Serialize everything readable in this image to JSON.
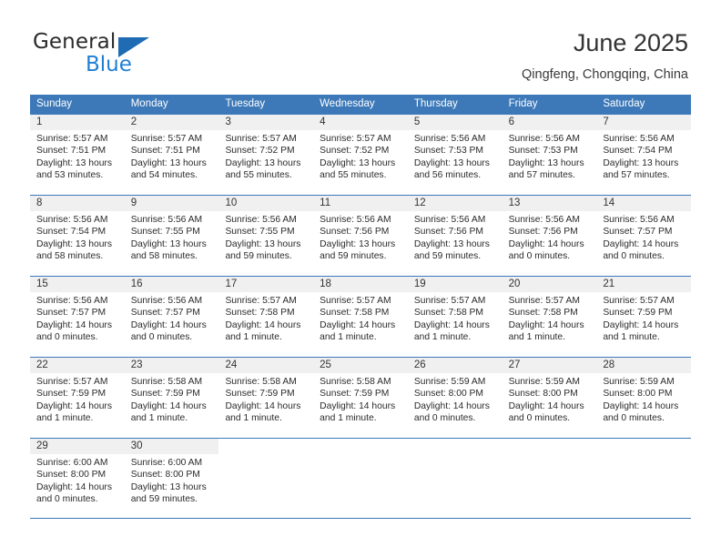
{
  "brand": {
    "name_part1": "General",
    "name_part2": "Blue",
    "triangle_color": "#1f6cb4",
    "blue_color": "#1f7fd4"
  },
  "header": {
    "title": "June 2025",
    "subtitle": "Qingfeng, Chongqing, China"
  },
  "colors": {
    "header_blue": "#3d79b9",
    "daynum_band": "#f0f0f0",
    "text": "#2b2b2b"
  },
  "weekdays": [
    "Sunday",
    "Monday",
    "Tuesday",
    "Wednesday",
    "Thursday",
    "Friday",
    "Saturday"
  ],
  "weeks": [
    [
      {
        "day": "1",
        "sunrise": "Sunrise: 5:57 AM",
        "sunset": "Sunset: 7:51 PM",
        "daylight_line1": "Daylight: 13 hours",
        "daylight_line2": "and 53 minutes."
      },
      {
        "day": "2",
        "sunrise": "Sunrise: 5:57 AM",
        "sunset": "Sunset: 7:51 PM",
        "daylight_line1": "Daylight: 13 hours",
        "daylight_line2": "and 54 minutes."
      },
      {
        "day": "3",
        "sunrise": "Sunrise: 5:57 AM",
        "sunset": "Sunset: 7:52 PM",
        "daylight_line1": "Daylight: 13 hours",
        "daylight_line2": "and 55 minutes."
      },
      {
        "day": "4",
        "sunrise": "Sunrise: 5:57 AM",
        "sunset": "Sunset: 7:52 PM",
        "daylight_line1": "Daylight: 13 hours",
        "daylight_line2": "and 55 minutes."
      },
      {
        "day": "5",
        "sunrise": "Sunrise: 5:56 AM",
        "sunset": "Sunset: 7:53 PM",
        "daylight_line1": "Daylight: 13 hours",
        "daylight_line2": "and 56 minutes."
      },
      {
        "day": "6",
        "sunrise": "Sunrise: 5:56 AM",
        "sunset": "Sunset: 7:53 PM",
        "daylight_line1": "Daylight: 13 hours",
        "daylight_line2": "and 57 minutes."
      },
      {
        "day": "7",
        "sunrise": "Sunrise: 5:56 AM",
        "sunset": "Sunset: 7:54 PM",
        "daylight_line1": "Daylight: 13 hours",
        "daylight_line2": "and 57 minutes."
      }
    ],
    [
      {
        "day": "8",
        "sunrise": "Sunrise: 5:56 AM",
        "sunset": "Sunset: 7:54 PM",
        "daylight_line1": "Daylight: 13 hours",
        "daylight_line2": "and 58 minutes."
      },
      {
        "day": "9",
        "sunrise": "Sunrise: 5:56 AM",
        "sunset": "Sunset: 7:55 PM",
        "daylight_line1": "Daylight: 13 hours",
        "daylight_line2": "and 58 minutes."
      },
      {
        "day": "10",
        "sunrise": "Sunrise: 5:56 AM",
        "sunset": "Sunset: 7:55 PM",
        "daylight_line1": "Daylight: 13 hours",
        "daylight_line2": "and 59 minutes."
      },
      {
        "day": "11",
        "sunrise": "Sunrise: 5:56 AM",
        "sunset": "Sunset: 7:56 PM",
        "daylight_line1": "Daylight: 13 hours",
        "daylight_line2": "and 59 minutes."
      },
      {
        "day": "12",
        "sunrise": "Sunrise: 5:56 AM",
        "sunset": "Sunset: 7:56 PM",
        "daylight_line1": "Daylight: 13 hours",
        "daylight_line2": "and 59 minutes."
      },
      {
        "day": "13",
        "sunrise": "Sunrise: 5:56 AM",
        "sunset": "Sunset: 7:56 PM",
        "daylight_line1": "Daylight: 14 hours",
        "daylight_line2": "and 0 minutes."
      },
      {
        "day": "14",
        "sunrise": "Sunrise: 5:56 AM",
        "sunset": "Sunset: 7:57 PM",
        "daylight_line1": "Daylight: 14 hours",
        "daylight_line2": "and 0 minutes."
      }
    ],
    [
      {
        "day": "15",
        "sunrise": "Sunrise: 5:56 AM",
        "sunset": "Sunset: 7:57 PM",
        "daylight_line1": "Daylight: 14 hours",
        "daylight_line2": "and 0 minutes."
      },
      {
        "day": "16",
        "sunrise": "Sunrise: 5:56 AM",
        "sunset": "Sunset: 7:57 PM",
        "daylight_line1": "Daylight: 14 hours",
        "daylight_line2": "and 0 minutes."
      },
      {
        "day": "17",
        "sunrise": "Sunrise: 5:57 AM",
        "sunset": "Sunset: 7:58 PM",
        "daylight_line1": "Daylight: 14 hours",
        "daylight_line2": "and 1 minute."
      },
      {
        "day": "18",
        "sunrise": "Sunrise: 5:57 AM",
        "sunset": "Sunset: 7:58 PM",
        "daylight_line1": "Daylight: 14 hours",
        "daylight_line2": "and 1 minute."
      },
      {
        "day": "19",
        "sunrise": "Sunrise: 5:57 AM",
        "sunset": "Sunset: 7:58 PM",
        "daylight_line1": "Daylight: 14 hours",
        "daylight_line2": "and 1 minute."
      },
      {
        "day": "20",
        "sunrise": "Sunrise: 5:57 AM",
        "sunset": "Sunset: 7:58 PM",
        "daylight_line1": "Daylight: 14 hours",
        "daylight_line2": "and 1 minute."
      },
      {
        "day": "21",
        "sunrise": "Sunrise: 5:57 AM",
        "sunset": "Sunset: 7:59 PM",
        "daylight_line1": "Daylight: 14 hours",
        "daylight_line2": "and 1 minute."
      }
    ],
    [
      {
        "day": "22",
        "sunrise": "Sunrise: 5:57 AM",
        "sunset": "Sunset: 7:59 PM",
        "daylight_line1": "Daylight: 14 hours",
        "daylight_line2": "and 1 minute."
      },
      {
        "day": "23",
        "sunrise": "Sunrise: 5:58 AM",
        "sunset": "Sunset: 7:59 PM",
        "daylight_line1": "Daylight: 14 hours",
        "daylight_line2": "and 1 minute."
      },
      {
        "day": "24",
        "sunrise": "Sunrise: 5:58 AM",
        "sunset": "Sunset: 7:59 PM",
        "daylight_line1": "Daylight: 14 hours",
        "daylight_line2": "and 1 minute."
      },
      {
        "day": "25",
        "sunrise": "Sunrise: 5:58 AM",
        "sunset": "Sunset: 7:59 PM",
        "daylight_line1": "Daylight: 14 hours",
        "daylight_line2": "and 1 minute."
      },
      {
        "day": "26",
        "sunrise": "Sunrise: 5:59 AM",
        "sunset": "Sunset: 8:00 PM",
        "daylight_line1": "Daylight: 14 hours",
        "daylight_line2": "and 0 minutes."
      },
      {
        "day": "27",
        "sunrise": "Sunrise: 5:59 AM",
        "sunset": "Sunset: 8:00 PM",
        "daylight_line1": "Daylight: 14 hours",
        "daylight_line2": "and 0 minutes."
      },
      {
        "day": "28",
        "sunrise": "Sunrise: 5:59 AM",
        "sunset": "Sunset: 8:00 PM",
        "daylight_line1": "Daylight: 14 hours",
        "daylight_line2": "and 0 minutes."
      }
    ],
    [
      {
        "day": "29",
        "sunrise": "Sunrise: 6:00 AM",
        "sunset": "Sunset: 8:00 PM",
        "daylight_line1": "Daylight: 14 hours",
        "daylight_line2": "and 0 minutes."
      },
      {
        "day": "30",
        "sunrise": "Sunrise: 6:00 AM",
        "sunset": "Sunset: 8:00 PM",
        "daylight_line1": "Daylight: 13 hours",
        "daylight_line2": "and 59 minutes."
      },
      {
        "day": "",
        "sunrise": "",
        "sunset": "",
        "daylight_line1": "",
        "daylight_line2": ""
      },
      {
        "day": "",
        "sunrise": "",
        "sunset": "",
        "daylight_line1": "",
        "daylight_line2": ""
      },
      {
        "day": "",
        "sunrise": "",
        "sunset": "",
        "daylight_line1": "",
        "daylight_line2": ""
      },
      {
        "day": "",
        "sunrise": "",
        "sunset": "",
        "daylight_line1": "",
        "daylight_line2": ""
      },
      {
        "day": "",
        "sunrise": "",
        "sunset": "",
        "daylight_line1": "",
        "daylight_line2": ""
      }
    ]
  ]
}
